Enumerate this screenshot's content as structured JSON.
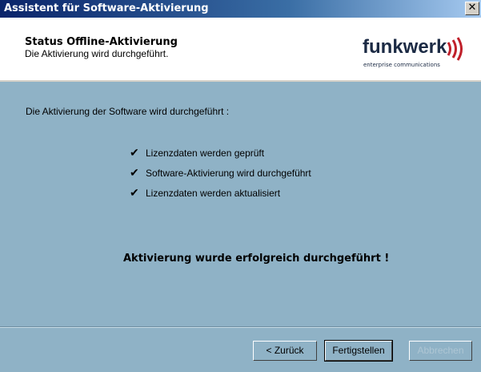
{
  "window": {
    "title": "Assistent für Software-Aktivierung"
  },
  "header": {
    "title": "Status Offline-Aktivierung",
    "subtitle": "Die Aktivierung wird durchgeführt.",
    "logo_word": "funkwerk",
    "logo_tagline": "enterprise communications"
  },
  "body": {
    "intro": "Die Aktivierung der Software wird durchgeführt :",
    "checks": [
      "Lizenzdaten werden geprüft",
      "Software-Aktivierung wird durchgeführt",
      "Lizenzdaten werden aktualisiert"
    ],
    "success": "Aktivierung wurde erfolgreich durchgeführt !"
  },
  "buttons": {
    "back": "< Zurück",
    "finish": "Fertigstellen",
    "cancel": "Abbrechen"
  },
  "icons": {
    "check": "✔",
    "close": "✕"
  },
  "colors": {
    "panel": "#8fb2c6",
    "titlebar": "#0a246a",
    "logo": "#1b2a44",
    "logo_waves": "#c0202a"
  }
}
